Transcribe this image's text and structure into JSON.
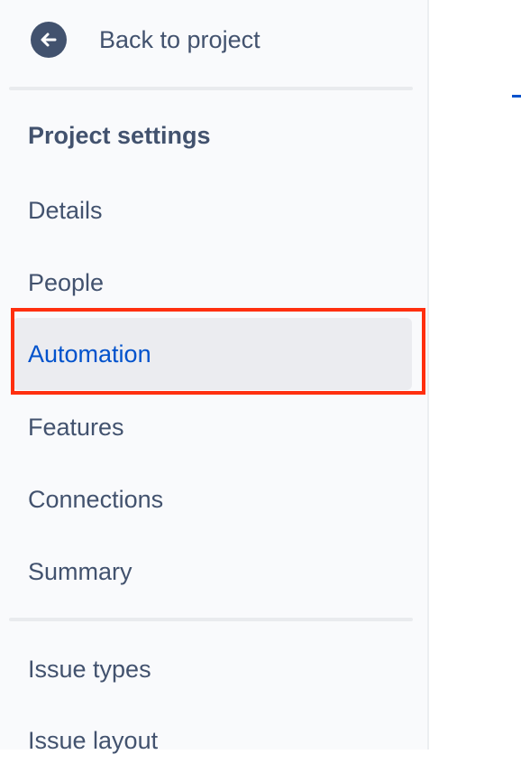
{
  "sidebar": {
    "back": {
      "label": "Back to project",
      "icon": "arrow-left-icon"
    },
    "section_title": "Project settings",
    "items": [
      {
        "label": "Details"
      },
      {
        "label": "People"
      },
      {
        "label": "Automation",
        "active": true
      },
      {
        "label": "Features"
      },
      {
        "label": "Connections"
      },
      {
        "label": "Summary"
      }
    ],
    "secondary_items": [
      {
        "label": "Issue types"
      },
      {
        "label": "Issue layout"
      }
    ]
  },
  "colors": {
    "text": "#42526e",
    "active_text": "#0052cc",
    "active_bg": "#ebecf0",
    "highlight_border": "#ff2f0f",
    "sidebar_bg": "#f9fafc"
  }
}
